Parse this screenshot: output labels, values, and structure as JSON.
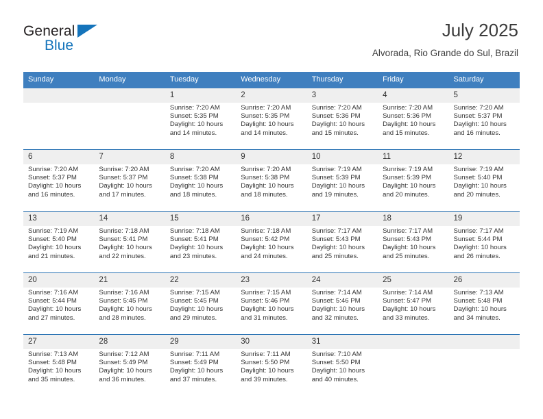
{
  "brand": {
    "name_top": "General",
    "name_bottom": "Blue",
    "accent_color": "#1574bb"
  },
  "header": {
    "title": "July 2025",
    "subtitle": "Alvorada, Rio Grande do Sul, Brazil"
  },
  "theme": {
    "header_bg": "#3f7fbf",
    "row_divider": "#1f6cb0",
    "daynum_bg": "#efefef",
    "text": "#333333"
  },
  "weekdays": [
    "Sunday",
    "Monday",
    "Tuesday",
    "Wednesday",
    "Thursday",
    "Friday",
    "Saturday"
  ],
  "weeks": [
    [
      {
        "day": "",
        "sunrise": "",
        "sunset": "",
        "daylight_line1": "",
        "daylight_line2": ""
      },
      {
        "day": "",
        "sunrise": "",
        "sunset": "",
        "daylight_line1": "",
        "daylight_line2": ""
      },
      {
        "day": "1",
        "sunrise": "Sunrise: 7:20 AM",
        "sunset": "Sunset: 5:35 PM",
        "daylight_line1": "Daylight: 10 hours",
        "daylight_line2": "and 14 minutes."
      },
      {
        "day": "2",
        "sunrise": "Sunrise: 7:20 AM",
        "sunset": "Sunset: 5:35 PM",
        "daylight_line1": "Daylight: 10 hours",
        "daylight_line2": "and 14 minutes."
      },
      {
        "day": "3",
        "sunrise": "Sunrise: 7:20 AM",
        "sunset": "Sunset: 5:36 PM",
        "daylight_line1": "Daylight: 10 hours",
        "daylight_line2": "and 15 minutes."
      },
      {
        "day": "4",
        "sunrise": "Sunrise: 7:20 AM",
        "sunset": "Sunset: 5:36 PM",
        "daylight_line1": "Daylight: 10 hours",
        "daylight_line2": "and 15 minutes."
      },
      {
        "day": "5",
        "sunrise": "Sunrise: 7:20 AM",
        "sunset": "Sunset: 5:37 PM",
        "daylight_line1": "Daylight: 10 hours",
        "daylight_line2": "and 16 minutes."
      }
    ],
    [
      {
        "day": "6",
        "sunrise": "Sunrise: 7:20 AM",
        "sunset": "Sunset: 5:37 PM",
        "daylight_line1": "Daylight: 10 hours",
        "daylight_line2": "and 16 minutes."
      },
      {
        "day": "7",
        "sunrise": "Sunrise: 7:20 AM",
        "sunset": "Sunset: 5:37 PM",
        "daylight_line1": "Daylight: 10 hours",
        "daylight_line2": "and 17 minutes."
      },
      {
        "day": "8",
        "sunrise": "Sunrise: 7:20 AM",
        "sunset": "Sunset: 5:38 PM",
        "daylight_line1": "Daylight: 10 hours",
        "daylight_line2": "and 18 minutes."
      },
      {
        "day": "9",
        "sunrise": "Sunrise: 7:20 AM",
        "sunset": "Sunset: 5:38 PM",
        "daylight_line1": "Daylight: 10 hours",
        "daylight_line2": "and 18 minutes."
      },
      {
        "day": "10",
        "sunrise": "Sunrise: 7:19 AM",
        "sunset": "Sunset: 5:39 PM",
        "daylight_line1": "Daylight: 10 hours",
        "daylight_line2": "and 19 minutes."
      },
      {
        "day": "11",
        "sunrise": "Sunrise: 7:19 AM",
        "sunset": "Sunset: 5:39 PM",
        "daylight_line1": "Daylight: 10 hours",
        "daylight_line2": "and 20 minutes."
      },
      {
        "day": "12",
        "sunrise": "Sunrise: 7:19 AM",
        "sunset": "Sunset: 5:40 PM",
        "daylight_line1": "Daylight: 10 hours",
        "daylight_line2": "and 20 minutes."
      }
    ],
    [
      {
        "day": "13",
        "sunrise": "Sunrise: 7:19 AM",
        "sunset": "Sunset: 5:40 PM",
        "daylight_line1": "Daylight: 10 hours",
        "daylight_line2": "and 21 minutes."
      },
      {
        "day": "14",
        "sunrise": "Sunrise: 7:18 AM",
        "sunset": "Sunset: 5:41 PM",
        "daylight_line1": "Daylight: 10 hours",
        "daylight_line2": "and 22 minutes."
      },
      {
        "day": "15",
        "sunrise": "Sunrise: 7:18 AM",
        "sunset": "Sunset: 5:41 PM",
        "daylight_line1": "Daylight: 10 hours",
        "daylight_line2": "and 23 minutes."
      },
      {
        "day": "16",
        "sunrise": "Sunrise: 7:18 AM",
        "sunset": "Sunset: 5:42 PM",
        "daylight_line1": "Daylight: 10 hours",
        "daylight_line2": "and 24 minutes."
      },
      {
        "day": "17",
        "sunrise": "Sunrise: 7:17 AM",
        "sunset": "Sunset: 5:43 PM",
        "daylight_line1": "Daylight: 10 hours",
        "daylight_line2": "and 25 minutes."
      },
      {
        "day": "18",
        "sunrise": "Sunrise: 7:17 AM",
        "sunset": "Sunset: 5:43 PM",
        "daylight_line1": "Daylight: 10 hours",
        "daylight_line2": "and 25 minutes."
      },
      {
        "day": "19",
        "sunrise": "Sunrise: 7:17 AM",
        "sunset": "Sunset: 5:44 PM",
        "daylight_line1": "Daylight: 10 hours",
        "daylight_line2": "and 26 minutes."
      }
    ],
    [
      {
        "day": "20",
        "sunrise": "Sunrise: 7:16 AM",
        "sunset": "Sunset: 5:44 PM",
        "daylight_line1": "Daylight: 10 hours",
        "daylight_line2": "and 27 minutes."
      },
      {
        "day": "21",
        "sunrise": "Sunrise: 7:16 AM",
        "sunset": "Sunset: 5:45 PM",
        "daylight_line1": "Daylight: 10 hours",
        "daylight_line2": "and 28 minutes."
      },
      {
        "day": "22",
        "sunrise": "Sunrise: 7:15 AM",
        "sunset": "Sunset: 5:45 PM",
        "daylight_line1": "Daylight: 10 hours",
        "daylight_line2": "and 29 minutes."
      },
      {
        "day": "23",
        "sunrise": "Sunrise: 7:15 AM",
        "sunset": "Sunset: 5:46 PM",
        "daylight_line1": "Daylight: 10 hours",
        "daylight_line2": "and 31 minutes."
      },
      {
        "day": "24",
        "sunrise": "Sunrise: 7:14 AM",
        "sunset": "Sunset: 5:46 PM",
        "daylight_line1": "Daylight: 10 hours",
        "daylight_line2": "and 32 minutes."
      },
      {
        "day": "25",
        "sunrise": "Sunrise: 7:14 AM",
        "sunset": "Sunset: 5:47 PM",
        "daylight_line1": "Daylight: 10 hours",
        "daylight_line2": "and 33 minutes."
      },
      {
        "day": "26",
        "sunrise": "Sunrise: 7:13 AM",
        "sunset": "Sunset: 5:48 PM",
        "daylight_line1": "Daylight: 10 hours",
        "daylight_line2": "and 34 minutes."
      }
    ],
    [
      {
        "day": "27",
        "sunrise": "Sunrise: 7:13 AM",
        "sunset": "Sunset: 5:48 PM",
        "daylight_line1": "Daylight: 10 hours",
        "daylight_line2": "and 35 minutes."
      },
      {
        "day": "28",
        "sunrise": "Sunrise: 7:12 AM",
        "sunset": "Sunset: 5:49 PM",
        "daylight_line1": "Daylight: 10 hours",
        "daylight_line2": "and 36 minutes."
      },
      {
        "day": "29",
        "sunrise": "Sunrise: 7:11 AM",
        "sunset": "Sunset: 5:49 PM",
        "daylight_line1": "Daylight: 10 hours",
        "daylight_line2": "and 37 minutes."
      },
      {
        "day": "30",
        "sunrise": "Sunrise: 7:11 AM",
        "sunset": "Sunset: 5:50 PM",
        "daylight_line1": "Daylight: 10 hours",
        "daylight_line2": "and 39 minutes."
      },
      {
        "day": "31",
        "sunrise": "Sunrise: 7:10 AM",
        "sunset": "Sunset: 5:50 PM",
        "daylight_line1": "Daylight: 10 hours",
        "daylight_line2": "and 40 minutes."
      },
      {
        "day": "",
        "sunrise": "",
        "sunset": "",
        "daylight_line1": "",
        "daylight_line2": ""
      },
      {
        "day": "",
        "sunrise": "",
        "sunset": "",
        "daylight_line1": "",
        "daylight_line2": ""
      }
    ]
  ]
}
